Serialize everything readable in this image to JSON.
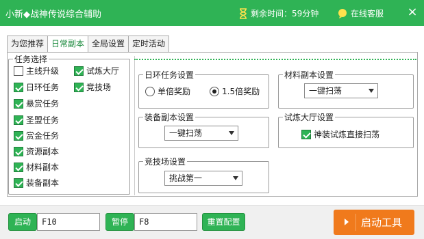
{
  "window": {
    "title": "小新◆战神传说综合辅助",
    "timer_text": "剩余时间：59分钟",
    "service_text": "在线客服",
    "close_glyph": "×"
  },
  "tabs": [
    {
      "label": "为您推荐",
      "active": false
    },
    {
      "label": "日常副本",
      "active": true
    },
    {
      "label": "全局设置",
      "active": false
    },
    {
      "label": "定时活动",
      "active": false
    }
  ],
  "task_group": {
    "title": "任务选择",
    "items": [
      {
        "label": "主线升级",
        "checked": false
      },
      {
        "label": "试炼大厅",
        "checked": true
      },
      {
        "label": "日环任务",
        "checked": true
      },
      {
        "label": "竞技场",
        "checked": true
      },
      {
        "label": "悬赏任务",
        "checked": true
      },
      {
        "label": "圣盟任务",
        "checked": true
      },
      {
        "label": "赏金任务",
        "checked": true
      },
      {
        "label": "资源副本",
        "checked": true
      },
      {
        "label": "材料副本",
        "checked": true
      },
      {
        "label": "装备副本",
        "checked": true
      }
    ]
  },
  "daily_ring": {
    "title": "日环任务设置",
    "options": [
      {
        "label": "单倍奖励",
        "checked": false
      },
      {
        "label": "1.5倍奖励",
        "checked": true
      }
    ]
  },
  "material_dungeon": {
    "title": "材料副本设置",
    "selected": "一键扫荡"
  },
  "equipment_dungeon": {
    "title": "装备副本设置",
    "selected": "一键扫荡"
  },
  "trial_hall": {
    "title": "试炼大厅设置",
    "option_label": "神装试炼直接扫荡",
    "checked": true
  },
  "arena": {
    "title": "竞技场设置",
    "selected": "挑战第一"
  },
  "bottom": {
    "start_label": "启动",
    "start_hotkey": "F10",
    "pause_label": "暂停",
    "pause_hotkey": "F8",
    "reset_label": "重置配置",
    "launch_label": "启动工具"
  },
  "colors": {
    "accent": "#2fb355",
    "launch": "#f07a1c"
  }
}
